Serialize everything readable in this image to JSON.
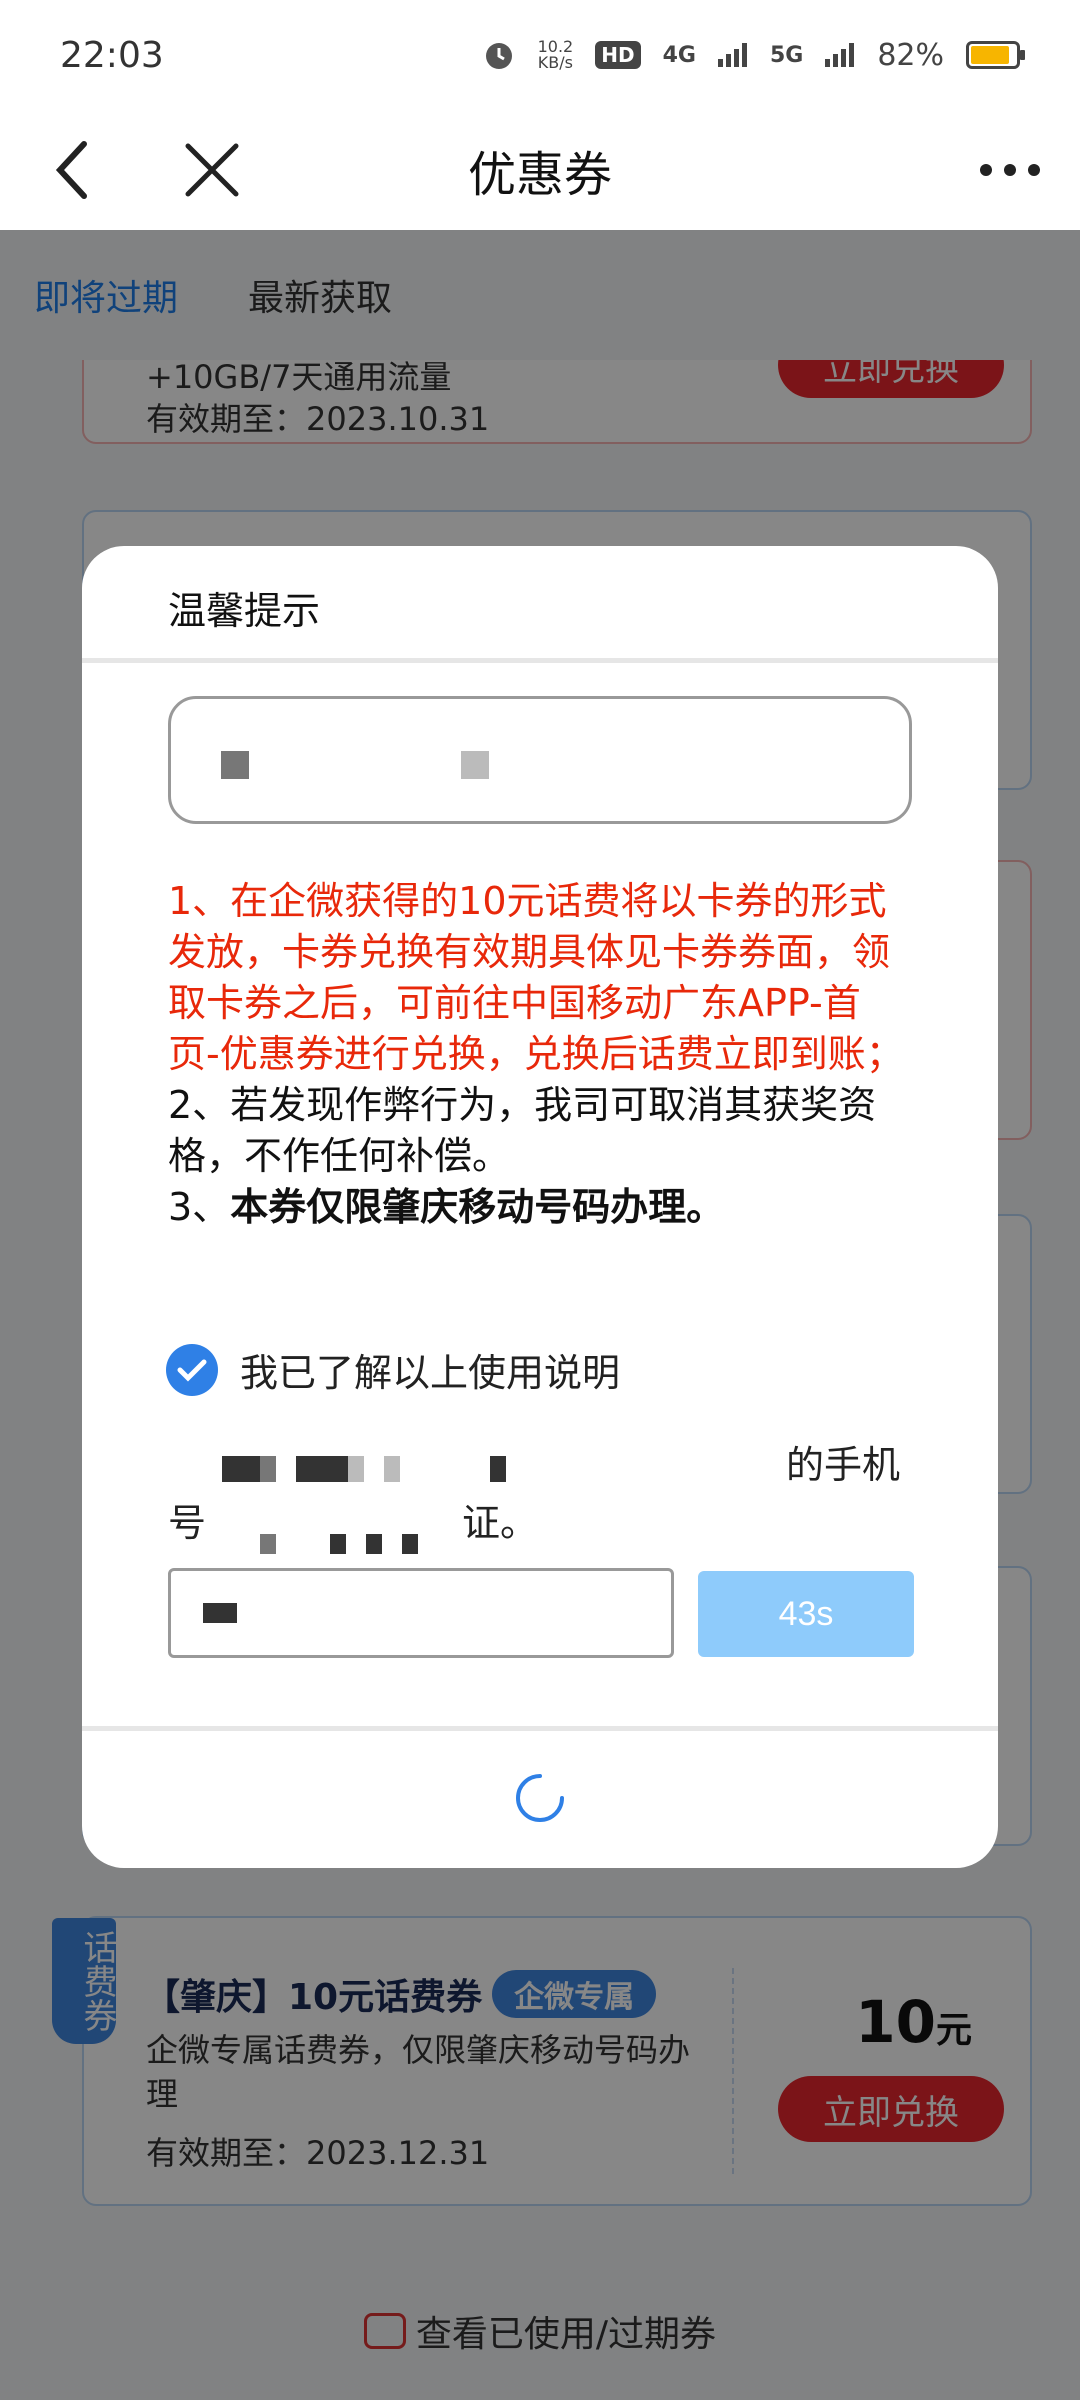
{
  "status_bar": {
    "time": "22:03",
    "net_speed_value": "10.2",
    "net_speed_unit": "KB/s",
    "hd_label": "HD",
    "sim1_label": "4G",
    "sim2_label": "5G",
    "battery_percent": "82%",
    "icons": [
      "alarm-icon",
      "hd-icon",
      "signal-icon",
      "battery-icon"
    ]
  },
  "header": {
    "title": "优惠券",
    "icons": [
      "back-icon",
      "close-icon",
      "more-icon"
    ]
  },
  "tabs": [
    {
      "label": "即将过期",
      "active": true
    },
    {
      "label": "最新获取",
      "active": false
    }
  ],
  "coupons": [
    {
      "desc": "+10GB/7天通用流量",
      "valid": "有效期至：2023.10.31",
      "button": "立即兑换"
    },
    {
      "tag": "话费券",
      "title": "【肇庆】10元话费券",
      "badge": "企微专属",
      "desc": "企微专属话费券，仅限肇庆移动号码办理",
      "valid": "有效期至：2023.12.31",
      "amount": "10",
      "unit": "元",
      "button": "立即兑换"
    }
  ],
  "footer": {
    "link": "查看已使用/过期券"
  },
  "modal": {
    "title": "温馨提示",
    "notice_red": "1、在企微获得的10元话费将以卡券的形式发放，卡券兑换有效期具体见卡券券面，领取卡券之后，可前往中国移动广东APP-首页-优惠券进行兑换，兑换后话费立即到账；",
    "notice_2": "2、若发现作弊行为，我司可取消其获奖资格，不作任何补偿。",
    "notice_3_prefix": "3、",
    "notice_3_bold": "本券仅限肇庆移动号码办理。",
    "agree_label": "我已了解以上使用说明",
    "phone_text_a": "的手机",
    "phone_text_b": "号",
    "phone_text_c": "证。",
    "countdown": "43s"
  },
  "colors": {
    "accent_blue": "#1f7ee8",
    "red": "#e9262e",
    "notice_red": "#e8280a",
    "countdown_bg": "#8ecbfb",
    "battery": "#f7b500"
  }
}
